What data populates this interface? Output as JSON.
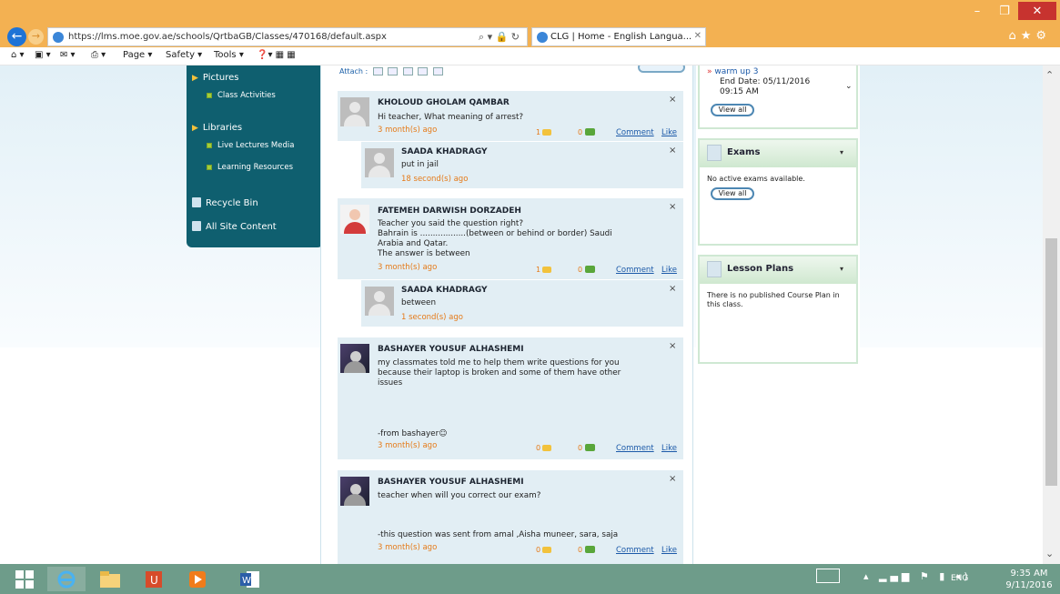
{
  "browser": {
    "url": "https://lms.moe.gov.ae/schools/QrtbaGB/Classes/470168/default.aspx",
    "tab_title": "CLG | Home - English Langua...",
    "cmd": {
      "page": "Page ▾",
      "safety": "Safety ▾",
      "tools": "Tools ▾"
    }
  },
  "sidebar": {
    "pictures": "Pictures",
    "class_activities": "Class Activities",
    "libraries": "Libraries",
    "live_lectures": "Live Lectures Media",
    "learning_resources": "Learning Resources",
    "recycle_bin": "Recycle Bin",
    "all_site_content": "All Site Content"
  },
  "feed": {
    "attach_label": "Attach :",
    "comment_label": "Comment",
    "like_label": "Like",
    "posts": [
      {
        "author": "KHOLOUD GHOLAM QAMBAR",
        "text": "Hi teacher, What meaning of arrest?",
        "time": "3 month(s) ago",
        "comments": "1",
        "likes": "0",
        "reply": {
          "author": "SAADA KHADRAGY",
          "text": "put in jail",
          "time": "18 second(s) ago"
        }
      },
      {
        "author": "FATEMEH DARWISH DORZADEH",
        "text": "Teacher you said the question right?",
        "text2": "Bahrain is ..................(between or behind or border) Saudi",
        "text3": "Arabia and Qatar.",
        "text4": "The answer is between",
        "time": "3 month(s) ago",
        "comments": "1",
        "likes": "0",
        "reply": {
          "author": "SAADA KHADRAGY",
          "text": "between",
          "time": "1 second(s) ago"
        }
      },
      {
        "author": "BASHAYER YOUSUF ALHASHEMI",
        "text": "my classmates told me to help them write questions for you",
        "text2": "because their laptop is broken and some of them have other",
        "text3": "issues",
        "sign": "-from bashayer☺",
        "time": "3 month(s) ago",
        "comments": "0",
        "likes": "0"
      },
      {
        "author": "BASHAYER YOUSUF ALHASHEMI",
        "text": "teacher when will you correct our exam?",
        "sign": "-this question was sent from amal ,Aisha muneer, sara, saja",
        "time": "3 month(s) ago",
        "comments": "0",
        "likes": "0"
      }
    ]
  },
  "right": {
    "assignment_title": "warm up 3",
    "end_date": "End Date: 05/11/2016",
    "end_time": "09:15 AM",
    "view_all": "View all",
    "exams_title": "Exams",
    "exams_text": "No active exams available.",
    "lesson_title": "Lesson Plans",
    "lesson_text1": "There is no published Course Plan in",
    "lesson_text2": "this class."
  },
  "taskbar": {
    "lang": "ENG",
    "time": "9:35 AM",
    "date": "9/11/2016"
  }
}
